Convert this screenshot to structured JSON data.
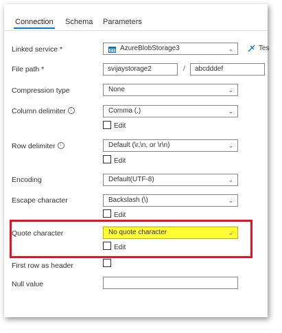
{
  "tabs": [
    "Connection",
    "Schema",
    "Parameters"
  ],
  "linked_service": {
    "label": "Linked service *",
    "value": "AzureBlobStorage3",
    "test_label": "Tes"
  },
  "file_path": {
    "label": "File path *",
    "container": "svijaystorage2",
    "separator": "/",
    "folder": "abcdddef"
  },
  "compression": {
    "label": "Compression type",
    "value": "None"
  },
  "column_delimiter": {
    "label": "Column delimiter",
    "value": "Comma (,)",
    "edit": "Edit"
  },
  "row_delimiter": {
    "label": "Row delimiter",
    "value": "Default (\\r,\\n, or \\r\\n)",
    "edit": "Edit"
  },
  "encoding": {
    "label": "Encoding",
    "value": "Default(UTF-8)"
  },
  "escape_character": {
    "label": "Escape character",
    "value": "Backslash (\\)",
    "edit": "Edit"
  },
  "quote_character": {
    "label": "Quote character",
    "value": "No quote character",
    "edit": "Edit"
  },
  "first_row_header": {
    "label": "First row as header"
  },
  "null_value": {
    "label": "Null value",
    "value": ""
  },
  "colors": {
    "accent": "#0078d4",
    "highlight": "#ffff33",
    "redbox": "#e81123"
  }
}
